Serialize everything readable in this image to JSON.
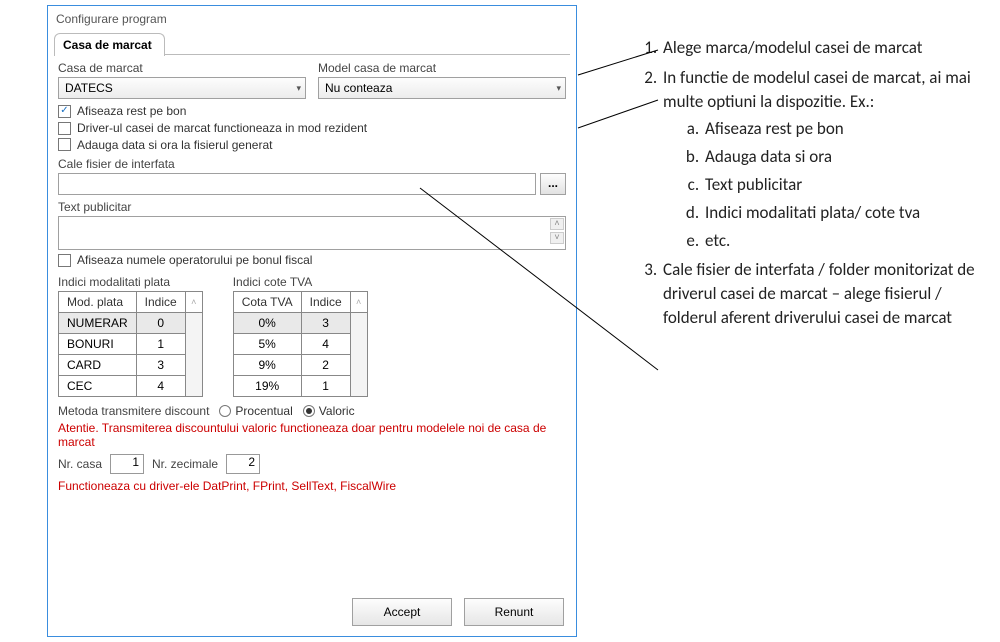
{
  "dialog": {
    "title": "Configurare program",
    "tab_label": "Casa de marcat",
    "brand_label": "Casa de marcat",
    "brand_value": "DATECS",
    "model_label": "Model casa de marcat",
    "model_value": "Nu conteaza",
    "chk_rest": "Afiseaza rest pe bon",
    "chk_rezident": "Driver-ul casei de marcat functioneaza in mod rezident",
    "chk_addtime": "Adauga data si ora la fisierul generat",
    "path_label": "Cale fisier de interfata",
    "path_value": "",
    "ellipsis": "...",
    "text_pub_label": "Text publicitar",
    "chk_operator": "Afiseaza numele operatorului pe bonul fiscal",
    "tbl_pay_caption": "Indici modalitati plata",
    "tbl_pay_h1": "Mod. plata",
    "tbl_pay_h2": "Indice",
    "tbl_pay_rows": [
      {
        "name": "NUMERAR",
        "idx": "0"
      },
      {
        "name": "BONURI",
        "idx": "1"
      },
      {
        "name": "CARD",
        "idx": "3"
      },
      {
        "name": "CEC",
        "idx": "4"
      }
    ],
    "tbl_tva_caption": "Indici cote TVA",
    "tbl_tva_h1": "Cota TVA",
    "tbl_tva_h2": "Indice",
    "tbl_tva_rows": [
      {
        "rate": "0%",
        "idx": "3"
      },
      {
        "rate": "5%",
        "idx": "4"
      },
      {
        "rate": "9%",
        "idx": "2"
      },
      {
        "rate": "19%",
        "idx": "1"
      }
    ],
    "radio_label": "Metoda transmitere discount",
    "radio_procentual": "Procentual",
    "radio_valoric": "Valoric",
    "warning": "Atentie. Transmiterea discountului valoric functioneaza doar pentru modelele noi de casa de marcat",
    "nr_casa_label": "Nr. casa",
    "nr_casa_value": "1",
    "nr_zecimale_label": "Nr. zecimale",
    "nr_zecimale_value": "2",
    "drivers_note": "Functioneaza cu driver-ele DatPrint, FPrint, SellText, FiscalWire",
    "btn_accept": "Accept",
    "btn_renunt": "Renunt"
  },
  "instructions": {
    "i1": "Alege marca/modelul casei de marcat",
    "i2": "In functie de modelul casei de marcat, ai mai multe optiuni la dispozitie. Ex.:",
    "i2a": "Afiseaza rest pe bon",
    "i2b": "Adauga data si ora",
    "i2c": "Text publicitar",
    "i2d": "Indici modalitati plata/ cote tva",
    "i2e": "etc.",
    "i3": "Cale fisier de interfata / folder monitorizat de driverul casei de marcat – alege fisierul / folderul aferent driverului casei de marcat"
  }
}
